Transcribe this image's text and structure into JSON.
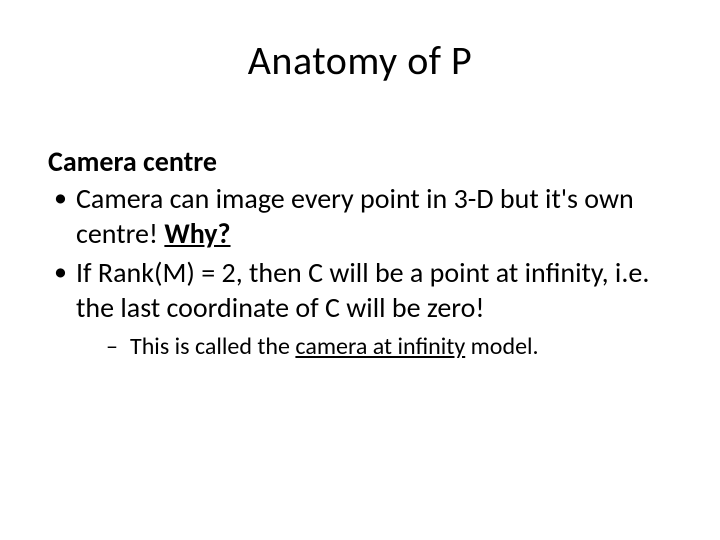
{
  "slide": {
    "title": "Anatomy of P",
    "section_heading": "Camera centre",
    "bullet1_a": "Camera can image every point in 3-D but it's own centre! ",
    "bullet1_b": "Why?",
    "bullet2": "If Rank(M) = 2, then C will be a point at infinity, i.e. the last coordinate of C will be zero!",
    "sub1_a": "This is called the ",
    "sub1_b": "camera at infinity",
    "sub1_c": " model."
  }
}
